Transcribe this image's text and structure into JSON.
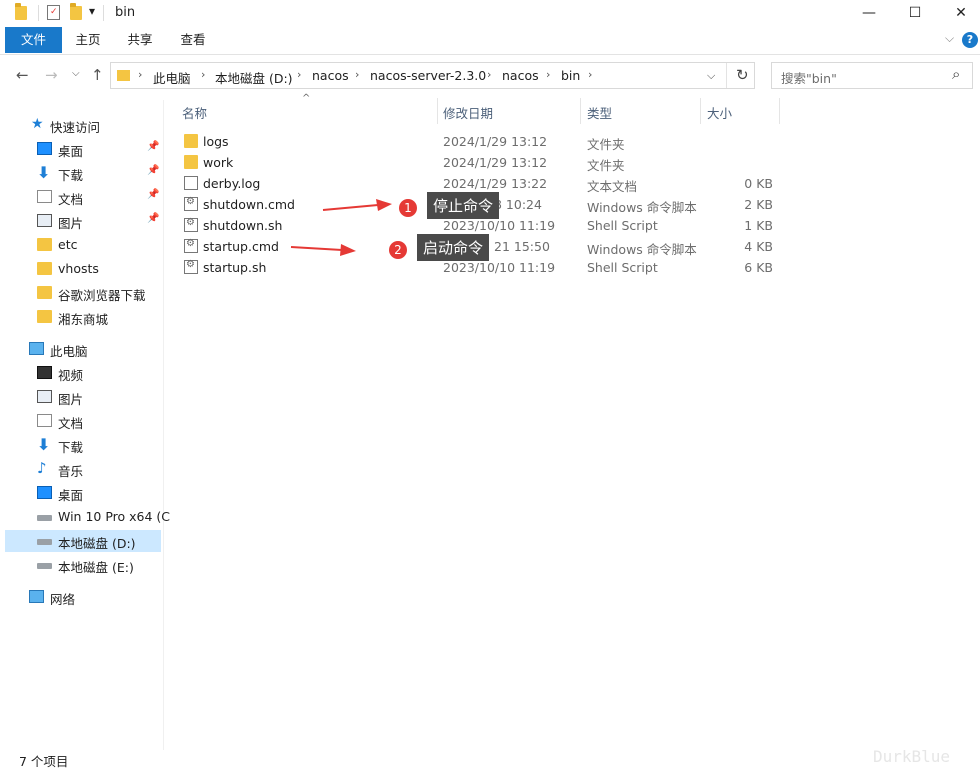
{
  "window": {
    "title": "bin",
    "minimize": "—",
    "maximize": "☐",
    "close": "✕"
  },
  "ribbon": {
    "tabs": [
      "文件",
      "主页",
      "共享",
      "查看"
    ],
    "collapse": "⌵",
    "help": "?"
  },
  "nav": {
    "back": "←",
    "forward": "→",
    "dropdown": "⌵",
    "up": "↑",
    "breadcrumb": [
      "此电脑",
      "本地磁盘 (D:)",
      "nacos",
      "nacos-server-2.3.0",
      "nacos",
      "bin"
    ],
    "address_dropdown": "⌵",
    "refresh": "↻",
    "search_placeholder": "搜索\"bin\"",
    "search_icon": "⌕"
  },
  "sidebar": {
    "quick_access": "快速访问",
    "quick_items": [
      {
        "label": "桌面",
        "icon": "desktop-icon",
        "pinned": true
      },
      {
        "label": "下载",
        "icon": "download-icon",
        "pinned": true
      },
      {
        "label": "文档",
        "icon": "document-icon",
        "pinned": true
      },
      {
        "label": "图片",
        "icon": "picture-icon",
        "pinned": true
      },
      {
        "label": "etc",
        "icon": "folder-icon",
        "pinned": false
      },
      {
        "label": "vhosts",
        "icon": "folder-icon",
        "pinned": false
      },
      {
        "label": "谷歌浏览器下载",
        "icon": "folder-icon",
        "pinned": false
      },
      {
        "label": "湘东商城",
        "icon": "folder-icon",
        "pinned": false
      }
    ],
    "this_pc": "此电脑",
    "pc_items": [
      {
        "label": "视频",
        "icon": "video-icon"
      },
      {
        "label": "图片",
        "icon": "picture-icon"
      },
      {
        "label": "文档",
        "icon": "document-icon"
      },
      {
        "label": "下载",
        "icon": "download-icon"
      },
      {
        "label": "音乐",
        "icon": "music-icon"
      },
      {
        "label": "桌面",
        "icon": "desktop-icon"
      },
      {
        "label": "Win 10 Pro x64 (C",
        "icon": "drive-icon"
      },
      {
        "label": "本地磁盘 (D:)",
        "icon": "drive-icon",
        "selected": true
      },
      {
        "label": "本地磁盘 (E:)",
        "icon": "drive-icon"
      }
    ],
    "network": "网络"
  },
  "columns": {
    "name": "名称",
    "date": "修改日期",
    "type": "类型",
    "size": "大小",
    "sort_indicator": "^"
  },
  "files": [
    {
      "name": "logs",
      "date": "2024/1/29 13:12",
      "type": "文件夹",
      "size": "",
      "icon": "folder-icon"
    },
    {
      "name": "work",
      "date": "2024/1/29 13:12",
      "type": "文件夹",
      "size": "",
      "icon": "folder-icon"
    },
    {
      "name": "derby.log",
      "date": "2024/1/29 13:22",
      "type": "文本文档",
      "size": "0 KB",
      "icon": "text-file-icon"
    },
    {
      "name": "shutdown.cmd",
      "date": "8 10:24",
      "type": "Windows 命令脚本",
      "size": "2 KB",
      "icon": "script-file-icon"
    },
    {
      "name": "shutdown.sh",
      "date": "2023/10/10 11:19",
      "type": "Shell Script",
      "size": "1 KB",
      "icon": "script-file-icon"
    },
    {
      "name": "startup.cmd",
      "date": "21 15:50",
      "type": "Windows 命令脚本",
      "size": "4 KB",
      "icon": "script-file-icon"
    },
    {
      "name": "startup.sh",
      "date": "2023/10/10 11:19",
      "type": "Shell Script",
      "size": "6 KB",
      "icon": "script-file-icon"
    }
  ],
  "annotations": [
    {
      "number": "1",
      "text": "停止命令"
    },
    {
      "number": "2",
      "text": "启动命令"
    }
  ],
  "status": {
    "item_count": "7 个项目"
  },
  "watermark": "DurkBlue",
  "colors": {
    "accent": "#1979ca",
    "selection": "#cce8ff",
    "annotation_arrow": "#e53935",
    "callout_bg": "#4a4a4a"
  }
}
